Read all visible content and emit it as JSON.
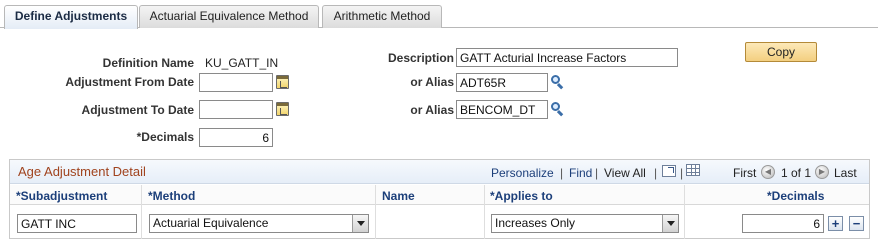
{
  "tabs": [
    {
      "label": "Define Adjustments",
      "active": true
    },
    {
      "label": "Actuarial Equivalence Method",
      "active": false
    },
    {
      "label": "Arithmetic Method",
      "active": false
    }
  ],
  "form": {
    "definition_name_label": "Definition Name",
    "definition_name_value": "KU_GATT_IN",
    "adj_from_label": "Adjustment From Date",
    "adj_from_value": "",
    "adj_to_label": "Adjustment To Date",
    "adj_to_value": "",
    "decimals_label": "*Decimals",
    "decimals_value": "6",
    "description_label": "Description",
    "description_value": "GATT Acturial Increase Factors",
    "alias1_label": "or Alias",
    "alias1_value": "ADT65R",
    "alias2_label": "or Alias",
    "alias2_value": "BENCOM_DT",
    "copy_label": "Copy"
  },
  "grid": {
    "title": "Age Adjustment Detail",
    "personalize": "Personalize",
    "find": "Find",
    "view_all": "View All",
    "sep": "|",
    "first": "First",
    "range": "1 of 1",
    "last": "Last",
    "columns": {
      "subadjustment": "*Subadjustment",
      "method": "*Method",
      "name": "Name",
      "applies_to": "*Applies to",
      "decimals": "*Decimals"
    },
    "row": {
      "subadjustment": "GATT INC",
      "method": "Actuarial Equivalence",
      "name": "",
      "applies_to": "Increases Only",
      "decimals": "6"
    },
    "add_label": "+",
    "delete_label": "−"
  },
  "icons": {
    "calendar": "calendar-icon",
    "lookup": "lookup-icon",
    "zoom": "zoom-icon",
    "download": "spreadsheet-icon"
  }
}
